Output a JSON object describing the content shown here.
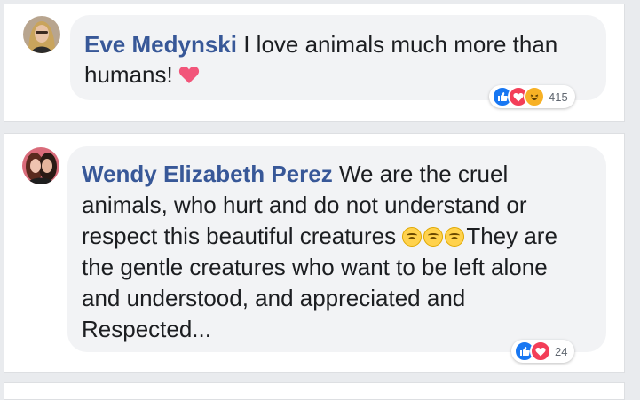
{
  "comments": [
    {
      "author": "Eve Medynski",
      "text": "I love animals much more than humans!",
      "reaction_icons": [
        "like-icon",
        "love-icon",
        "haha-icon"
      ],
      "reaction_count": "415"
    },
    {
      "author": "Wendy Elizabeth Perez",
      "text_before_emoji": "We are the cruel animals, who hurt and do not understand or respect this beautiful creatures",
      "emoji_icons": [
        "tired-face-icon",
        "sleepy-face-icon",
        "sad-face-icon"
      ],
      "text_after_emoji": "They are the gentle creatures who want to be left alone and understood, and appreciated and Respected...",
      "reaction_icons": [
        "like-icon",
        "love-icon"
      ],
      "reaction_count": "24"
    }
  ],
  "colors": {
    "author": "#385898",
    "bubble": "#f2f3f5",
    "like": "#1877f2",
    "love": "#f33e58",
    "haha": "#f7b125"
  }
}
